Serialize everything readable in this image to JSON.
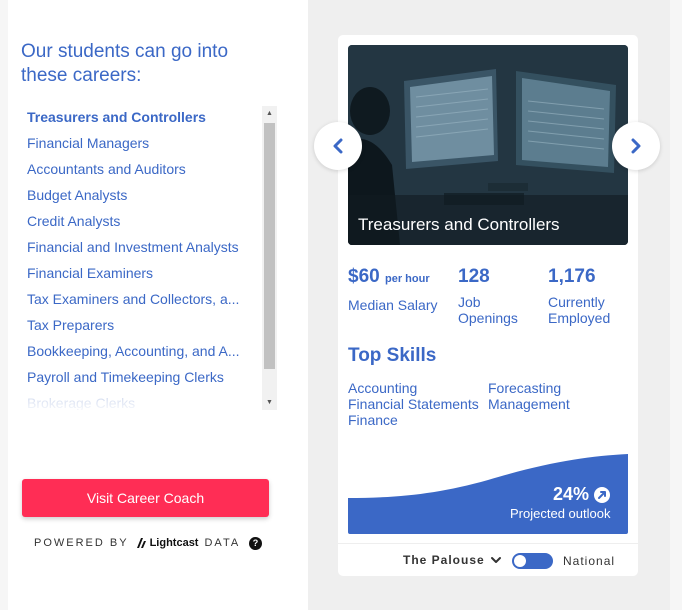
{
  "heading": "Our students can go into these careers:",
  "careers": [
    "Treasurers and Controllers",
    "Financial Managers",
    "Accountants and Auditors",
    "Budget Analysts",
    "Credit Analysts",
    "Financial and Investment Analysts",
    "Financial Examiners",
    "Tax Examiners and Collectors, a...",
    "Tax Preparers",
    "Bookkeeping, Accounting, and A...",
    "Payroll and Timekeeping Clerks",
    "Brokerage Clerks"
  ],
  "selected_career": "Treasurers and Controllers",
  "cta_label": "Visit Career Coach",
  "powered": {
    "prefix": "POWERED BY",
    "brand": "Lightcast",
    "suffix": "DATA",
    "help": "?"
  },
  "card": {
    "title": "Treasurers and Controllers",
    "salary_value": "$60",
    "salary_unit": "per hour",
    "salary_label": "Median Salary",
    "openings_value": "128",
    "openings_label": "Job Openings",
    "employed_value": "1,176",
    "employed_label": "Currently Employed",
    "skills_title": "Top Skills",
    "skills": [
      "Accounting",
      "Forecasting",
      "Financial Statements",
      "Management",
      "Finance"
    ],
    "outlook_value": "24%",
    "outlook_label": "Projected outlook",
    "region": "The Palouse",
    "national": "National"
  },
  "colors": {
    "accent": "#3b68c6",
    "cta": "#ff2d55",
    "panel": "#efefef"
  },
  "icons": {
    "prev": "chevron-left-icon",
    "next": "chevron-right-icon",
    "trend": "trend-up-icon",
    "region": "chevron-down-icon"
  }
}
